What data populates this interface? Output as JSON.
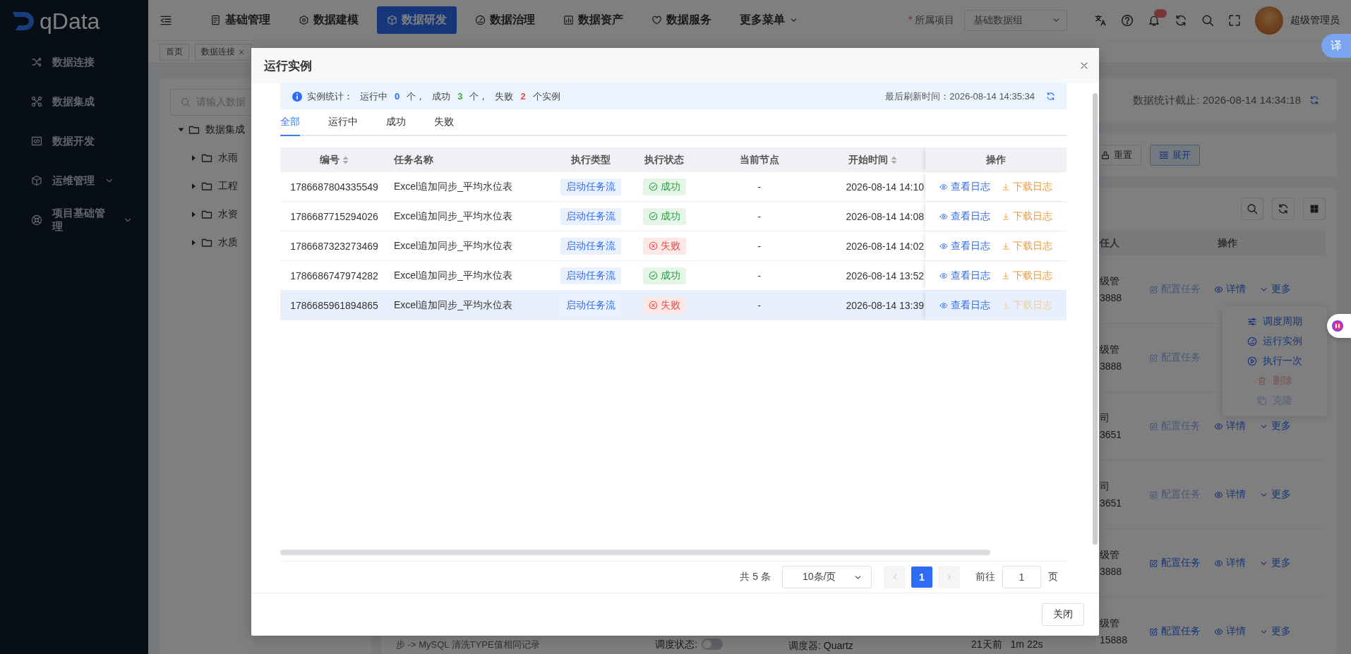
{
  "sidebar": {
    "logo": "qData",
    "items": [
      {
        "label": "数据连接",
        "kind": "link"
      },
      {
        "label": "数据集成",
        "kind": "link"
      },
      {
        "label": "数据开发",
        "kind": "link"
      },
      {
        "label": "运维管理",
        "kind": "group"
      },
      {
        "label": "项目基础管理",
        "kind": "group"
      }
    ]
  },
  "header": {
    "nav": [
      {
        "label": "基础管理",
        "selected": false
      },
      {
        "label": "数据建模",
        "selected": false
      },
      {
        "label": "数据研发",
        "selected": true
      },
      {
        "label": "数据治理",
        "selected": false
      },
      {
        "label": "数据资产",
        "selected": false
      },
      {
        "label": "数据服务",
        "selected": false
      }
    ],
    "more_menu": "更多菜单",
    "required_mark": "*",
    "project_label": "所属项目",
    "project": "基础数据组",
    "user": "超级管理员",
    "translate_button": "译"
  },
  "tags": [
    {
      "label": "首页",
      "closable": false
    },
    {
      "label": "数据连接",
      "closable": true
    }
  ],
  "tree": {
    "search_placeholder": "请输入数据",
    "nodes": [
      {
        "label": "数据集成",
        "expanded": true,
        "children": [
          {
            "label": "水雨",
            "expanded": false
          },
          {
            "label": "工程",
            "expanded": false
          },
          {
            "label": "水资",
            "expanded": false
          },
          {
            "label": "水质",
            "expanded": false
          }
        ]
      }
    ]
  },
  "page": {
    "stats_time": "数据统计截止: 2026-08-14 14:34:18",
    "filter_buttons": [
      "重置",
      "展开"
    ],
    "columns": [
      "任人",
      "操作"
    ],
    "rows": [
      {
        "owner": "级管",
        "phone": "3888",
        "config_disabled": true,
        "actions": [
          "配置任务",
          "详情",
          "更多"
        ]
      },
      {
        "owner": "级管",
        "phone": "3888",
        "config_disabled": true,
        "actions": [
          "配置任务"
        ]
      },
      {
        "owner": "司",
        "phone": "3651",
        "config_disabled": true,
        "actions": [
          "配置任务",
          "详情",
          "更多"
        ]
      },
      {
        "owner": "司",
        "phone": "3651",
        "config_disabled": true,
        "actions": [
          "配置任务",
          "详情",
          "更多"
        ]
      },
      {
        "owner": "级管",
        "phone": "3888",
        "config_disabled": false,
        "actions": [
          "配置任务",
          "详情",
          "更多"
        ]
      },
      {
        "owner": "级管",
        "phone": "15888",
        "config_disabled": false,
        "actions": [
          "配置任务",
          "详情",
          "更多"
        ],
        "task": "步 -> MySQL 清洗TYPE值相同记录",
        "schedule_label": "调度状态:",
        "schedule_on": false,
        "scheduler": "调度器: Quartz",
        "last_run": "21天前",
        "duration": "1m 22s"
      }
    ],
    "more_menu": [
      {
        "label": "调度周期",
        "disabled": false
      },
      {
        "label": "运行实例",
        "disabled": false
      },
      {
        "label": "执行一次",
        "disabled": false
      },
      {
        "label": "删除",
        "disabled": true
      },
      {
        "label": "克隆",
        "disabled": true
      }
    ]
  },
  "dialog": {
    "title": "运行实例",
    "summary": {
      "label": "实例统计：",
      "items": [
        {
          "label": "运行中",
          "count": "0",
          "unit": "个，",
          "color": "#2a6df4"
        },
        {
          "label": "成功",
          "count": "3",
          "unit": "个，",
          "color": "#3cb034"
        },
        {
          "label": "失败",
          "count": "2",
          "unit": "个实例",
          "color": "#f0494b"
        }
      ]
    },
    "refreshed": "最后刷新时间：2026-08-14 14:35:34",
    "tabs": [
      {
        "label": "全部",
        "selected": true
      },
      {
        "label": "运行中",
        "selected": false
      },
      {
        "label": "成功",
        "selected": false
      },
      {
        "label": "失败",
        "selected": false
      }
    ],
    "columns": [
      {
        "label": "编号",
        "sortable": true
      },
      {
        "label": "任务名称",
        "sortable": false
      },
      {
        "label": "执行类型",
        "sortable": false
      },
      {
        "label": "执行状态",
        "sortable": false
      },
      {
        "label": "当前节点",
        "sortable": false
      },
      {
        "label": "开始时间",
        "sortable": true
      },
      {
        "label": "操作",
        "sortable": false
      }
    ],
    "rows": [
      {
        "id": "1786687804335549",
        "name": "Excel追加同步_平均水位表",
        "type": "启动任务流",
        "status": {
          "label": "成功",
          "kind": "success"
        },
        "node": "-",
        "start": "2026-08-14 14:10",
        "view": "查看日志",
        "download": "下载日志",
        "download_disabled": false,
        "selected": false
      },
      {
        "id": "1786687715294026",
        "name": "Excel追加同步_平均水位表",
        "type": "启动任务流",
        "status": {
          "label": "成功",
          "kind": "success"
        },
        "node": "-",
        "start": "2026-08-14 14:08",
        "view": "查看日志",
        "download": "下载日志",
        "download_disabled": false,
        "selected": false
      },
      {
        "id": "1786687323273469",
        "name": "Excel追加同步_平均水位表",
        "type": "启动任务流",
        "status": {
          "label": "失败",
          "kind": "failed"
        },
        "node": "-",
        "start": "2026-08-14 14:02",
        "view": "查看日志",
        "download": "下载日志",
        "download_disabled": false,
        "selected": false
      },
      {
        "id": "1786686747974282",
        "name": "Excel追加同步_平均水位表",
        "type": "启动任务流",
        "status": {
          "label": "成功",
          "kind": "success"
        },
        "node": "-",
        "start": "2026-08-14 13:52",
        "view": "查看日志",
        "download": "下载日志",
        "download_disabled": false,
        "selected": false
      },
      {
        "id": "1786685961894865",
        "name": "Excel追加同步_平均水位表",
        "type": "启动任务流",
        "status": {
          "label": "失败",
          "kind": "failed"
        },
        "node": "-",
        "start": "2026-08-14 13:39",
        "view": "查看日志",
        "download": "下载日志",
        "download_disabled": true,
        "selected": true
      }
    ],
    "pagination": {
      "total": "共 5 条",
      "page_size": "10条/页",
      "pages": [
        {
          "label": "1",
          "selected": true
        }
      ],
      "goto_label": "前往",
      "goto_value": "1",
      "page_unit": "页"
    },
    "close_button": "关闭"
  }
}
